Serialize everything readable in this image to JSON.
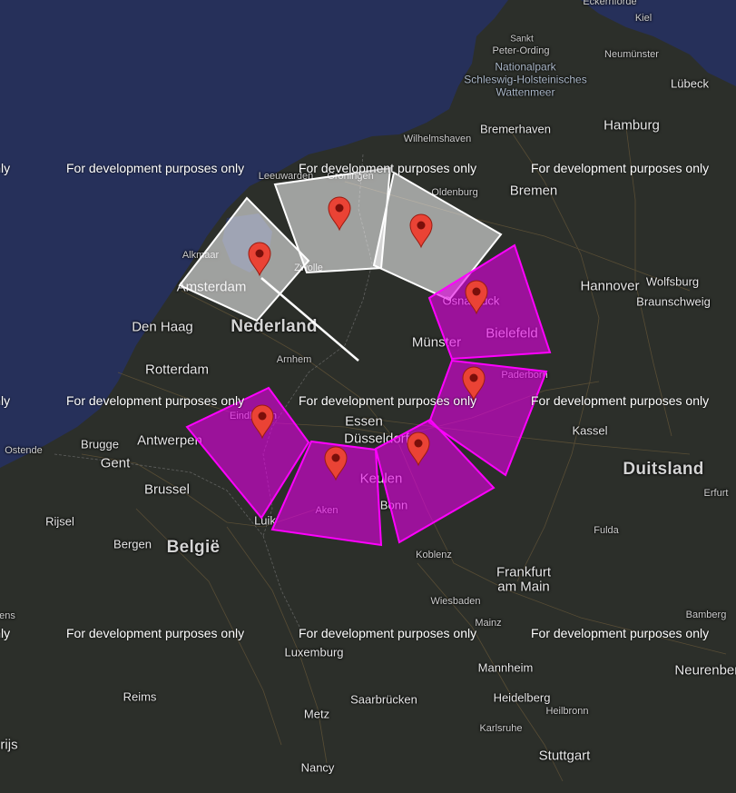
{
  "watermark": "For development purposes only",
  "colors": {
    "sea": "#2a355a",
    "land": "#2c2f2a",
    "highlight_polygon": "#e600e6",
    "white_polygon": "#ffffff",
    "marker": "#ea4335"
  },
  "places": {
    "eckernforde": "Eckernförde",
    "kiel": "Kiel",
    "sankt": "Sankt",
    "peter_ording": "Peter-Ording",
    "neumunster": "Neumünster",
    "nationalpark": "Nationalpark",
    "schleswig": "Schleswig-Holsteinisches",
    "wattenmeer": "Wattenmeer",
    "lubeck": "Lübeck",
    "bremerhaven": "Bremerhaven",
    "hamburg": "Hamburg",
    "wilhelmshaven": "Wilhelmshaven",
    "bremen": "Bremen",
    "leeuwarden": "Leeuwarden",
    "groningen": "Groningen",
    "oldenburg": "Oldenburg",
    "alkmaar": "Alkmaar",
    "zwolle": "Zwolle",
    "hannover": "Hannover",
    "wolfsburg": "Wolfsburg",
    "amsterdam": "Amsterdam",
    "braunschweig": "Braunschweig",
    "osnabruck": "Osnabrück",
    "den_haag": "Den Haag",
    "nederland": "Nederland",
    "bielefeld": "Bielefeld",
    "munster": "Münster",
    "rotterdam": "Rotterdam",
    "arnhem": "Arnhem",
    "paderborn": "Paderborn",
    "eindhoven": "Eindhoven",
    "essen": "Essen",
    "kassel": "Kassel",
    "ostende": "Ostende",
    "brugge": "Brugge",
    "antwerpen": "Antwerpen",
    "dusseldorf": "Düsseldorf",
    "gent": "Gent",
    "keulen": "Keulen",
    "duitsland": "Duitsland",
    "brussel": "Brussel",
    "bonn": "Bonn",
    "erfurt": "Erfurt",
    "aken": "Aken",
    "rijsel": "Rijsel",
    "luik": "Luik",
    "fulda": "Fulda",
    "bergen": "Bergen",
    "belgie": "België",
    "koblenz": "Koblenz",
    "frankfurt": "Frankfurt",
    "am_main": "am Main",
    "wiesbaden": "Wiesbaden",
    "mainz": "Mainz",
    "bamberg": "Bamberg",
    "luxemburg": "Luxemburg",
    "neurenberg": "Neurenberg",
    "mannheim": "Mannheim",
    "heidelberg": "Heidelberg",
    "reims": "Reims",
    "saarbrucken": "Saarbrücken",
    "heilbronn": "Heilbronn",
    "metz": "Metz",
    "karlsruhe": "Karlsruhe",
    "stuttgart": "Stuttgart",
    "nancy": "Nancy",
    "parijs": "rijs",
    "lens": "ens"
  },
  "markers": [
    {
      "name": "marker-amsterdam"
    },
    {
      "name": "marker-zwolle"
    },
    {
      "name": "marker-groningen-east"
    },
    {
      "name": "marker-osnabruck"
    },
    {
      "name": "marker-paderborn"
    },
    {
      "name": "marker-eindhoven"
    },
    {
      "name": "marker-aken"
    },
    {
      "name": "marker-keulen"
    }
  ]
}
